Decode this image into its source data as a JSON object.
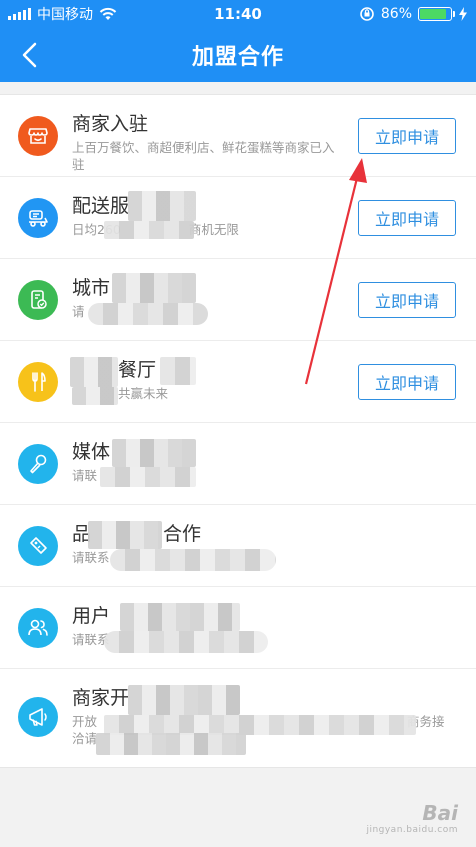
{
  "status_bar": {
    "carrier": "中国移动",
    "time": "11:40",
    "battery": "86%",
    "battery_level": 0.86
  },
  "nav": {
    "title": "加盟合作"
  },
  "items": [
    {
      "title": "商家入驻",
      "desc": "上百万餐饮、商超便利店、鲜花蛋糕等商家已入驻",
      "button": "立即申请",
      "icon": "store-icon",
      "color": "#f05a1e"
    },
    {
      "title": "配送服",
      "desc": "日均260",
      "desc2": "商机无限",
      "button": "立即申请",
      "icon": "scooter-icon",
      "color": "#2196f3"
    },
    {
      "title": "城市",
      "desc": "请",
      "button": "立即申请",
      "icon": "phone-check-icon",
      "color": "#3cba54"
    },
    {
      "title": "餐厅",
      "desc": "共赢未来",
      "button": "立即申请",
      "icon": "fork-knife-icon",
      "color": "#f7c21a"
    },
    {
      "title": "媒体",
      "desc": "请联",
      "icon": "microphone-icon",
      "color": "#22b4ec"
    },
    {
      "title": "品",
      "title2": "合作",
      "desc": "请联系",
      "icon": "tag-icon",
      "color": "#22b4ec"
    },
    {
      "title": "用户",
      "desc": "请联系",
      "icon": "users-icon",
      "color": "#22b4ec"
    },
    {
      "title": "商家开",
      "desc": "开放",
      "desc2": "商务接",
      "desc3": "洽请",
      "icon": "megaphone-icon",
      "color": "#22b4ec"
    }
  ],
  "watermark": {
    "text": "Bai",
    "sub": "jingyan.baidu.com"
  }
}
